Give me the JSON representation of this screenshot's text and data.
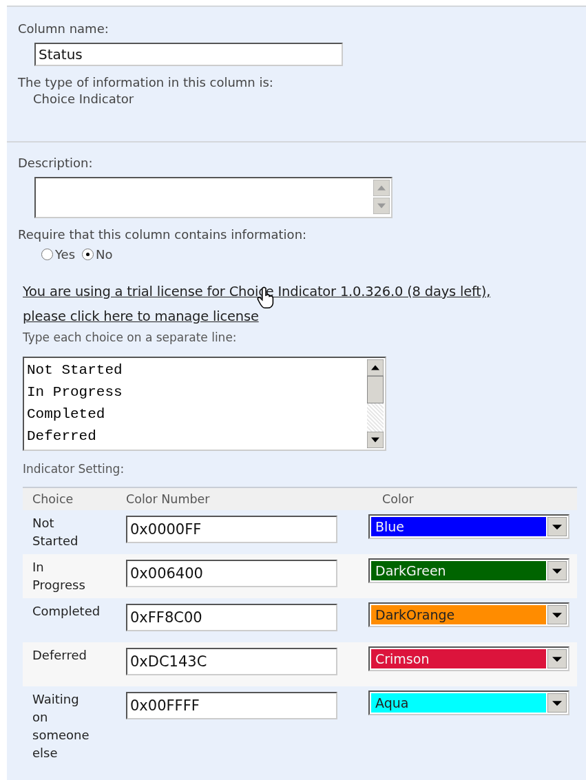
{
  "column_name": {
    "label": "Column name:",
    "value": "Status"
  },
  "type_info": {
    "label": "The type of information in this column is:",
    "value": "Choice Indicator"
  },
  "description": {
    "label": "Description:"
  },
  "require": {
    "label": "Require that this column contains information:",
    "options": [
      {
        "label": "Yes",
        "selected": false
      },
      {
        "label": "No",
        "selected": true
      }
    ]
  },
  "license_link": {
    "lines": [
      "You are using a trial license for Choice Indicator 1.0.326.0 (8 days left),",
      "please click here to manage license"
    ]
  },
  "choices": {
    "label": "Type each choice on a separate line:",
    "lines": [
      "Not Started",
      "In Progress",
      "Completed",
      "Deferred"
    ]
  },
  "indicator": {
    "label": "Indicator Setting:",
    "columns": [
      "Choice",
      "Color Number",
      "Color"
    ],
    "rows": [
      {
        "choice": "Not Started",
        "color_number": "0x0000FF",
        "color_name": "Blue",
        "color": "#0000ff"
      },
      {
        "choice": "In Progress",
        "color_number": "0x006400",
        "color_name": "DarkGreen",
        "color": "#006400"
      },
      {
        "choice": "Completed",
        "color_number": "0xFF8C00",
        "color_name": "DarkOrange",
        "color": "#ff8c00"
      },
      {
        "choice": "Deferred",
        "color_number": "0xDC143C",
        "color_name": "Crimson",
        "color": "#dc143c"
      },
      {
        "choice": "Waiting on someone else",
        "color_number": "0x00FFFF",
        "color_name": "Aqua",
        "color": "#00ffff"
      }
    ]
  }
}
